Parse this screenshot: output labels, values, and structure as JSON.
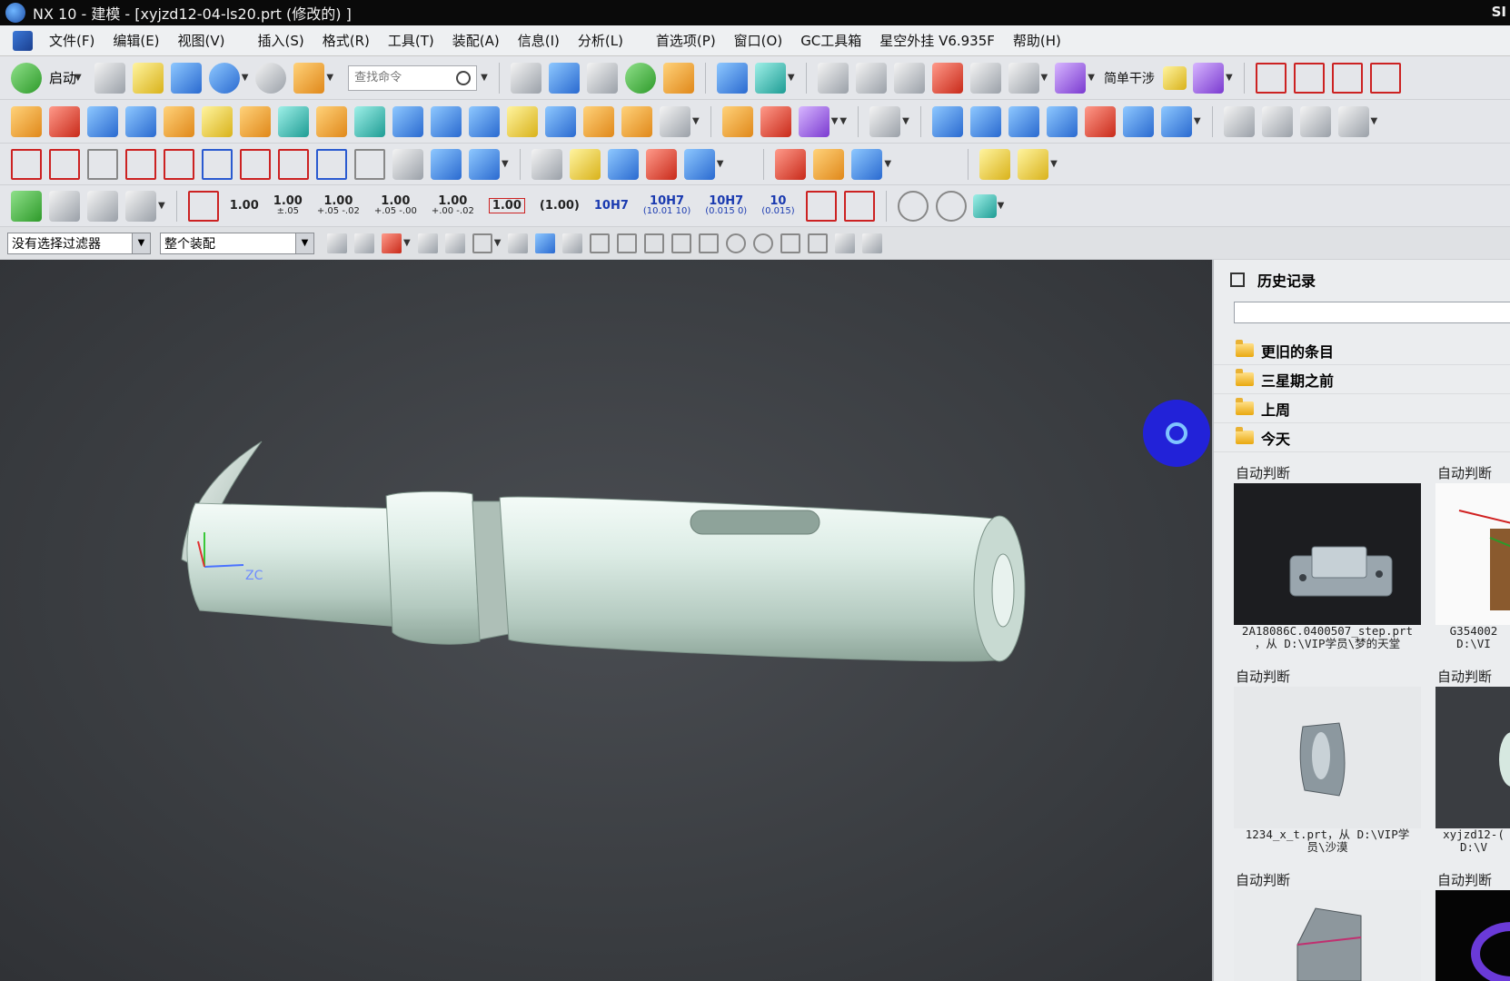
{
  "title_bar": {
    "title": "NX 10 - 建模 - [xyjzd12-04-ls20.prt  (修改的)  ]",
    "right_mark": "SI"
  },
  "menu": {
    "items": [
      "文件(F)",
      "编辑(E)",
      "视图(V)",
      "插入(S)",
      "格式(R)",
      "工具(T)",
      "装配(A)",
      "信息(I)",
      "分析(L)",
      "首选项(P)",
      "窗口(O)",
      "GC工具箱",
      "星空外挂 V6.935F",
      "帮助(H)"
    ]
  },
  "toolbar1": {
    "launch_label": "启动",
    "search_placeholder": "查找命令",
    "simple_interference": "简单干涉"
  },
  "dimension_toolbar": {
    "values": [
      "1.00",
      "1.00",
      "1.00",
      "1.00",
      "1.00",
      "1.00",
      "(1.00)",
      "10H7",
      "10H7",
      "10H7",
      "10"
    ],
    "subs": [
      "",
      "±.05",
      "+.05 -.02",
      "+.05 -.00",
      "+.00 -.02",
      "",
      "",
      "",
      "(10.01 10)",
      "(0.015 0)",
      "(0.015)"
    ]
  },
  "selection_bar": {
    "filter": "没有选择过滤器",
    "scope": "整个装配"
  },
  "viewport": {
    "axis_label": "ZC",
    "background": "#3c3f43",
    "part_color": "#d6e8e0"
  },
  "history": {
    "title": "历史记录",
    "groups": [
      "更旧的条目",
      "三星期之前",
      "上周",
      "今天"
    ],
    "cards": [
      {
        "caption": "自动判断",
        "desc1": "2A18086C.0400507_step.prt",
        "desc2": "，从 D:\\VIP学员\\梦的天堂"
      },
      {
        "caption": "自动判断",
        "desc1": "G354002",
        "desc2": "D:\\VI"
      },
      {
        "caption": "自动判断",
        "desc1": "1234_x_t.prt，从 D:\\VIP学",
        "desc2": "员\\沙漠"
      },
      {
        "caption": "自动判断",
        "desc1": "xyjzd12-(",
        "desc2": "D:\\V"
      },
      {
        "caption": "自动判断",
        "desc1": "",
        "desc2": ""
      },
      {
        "caption": "自动判断",
        "desc1": "",
        "desc2": ""
      }
    ]
  }
}
